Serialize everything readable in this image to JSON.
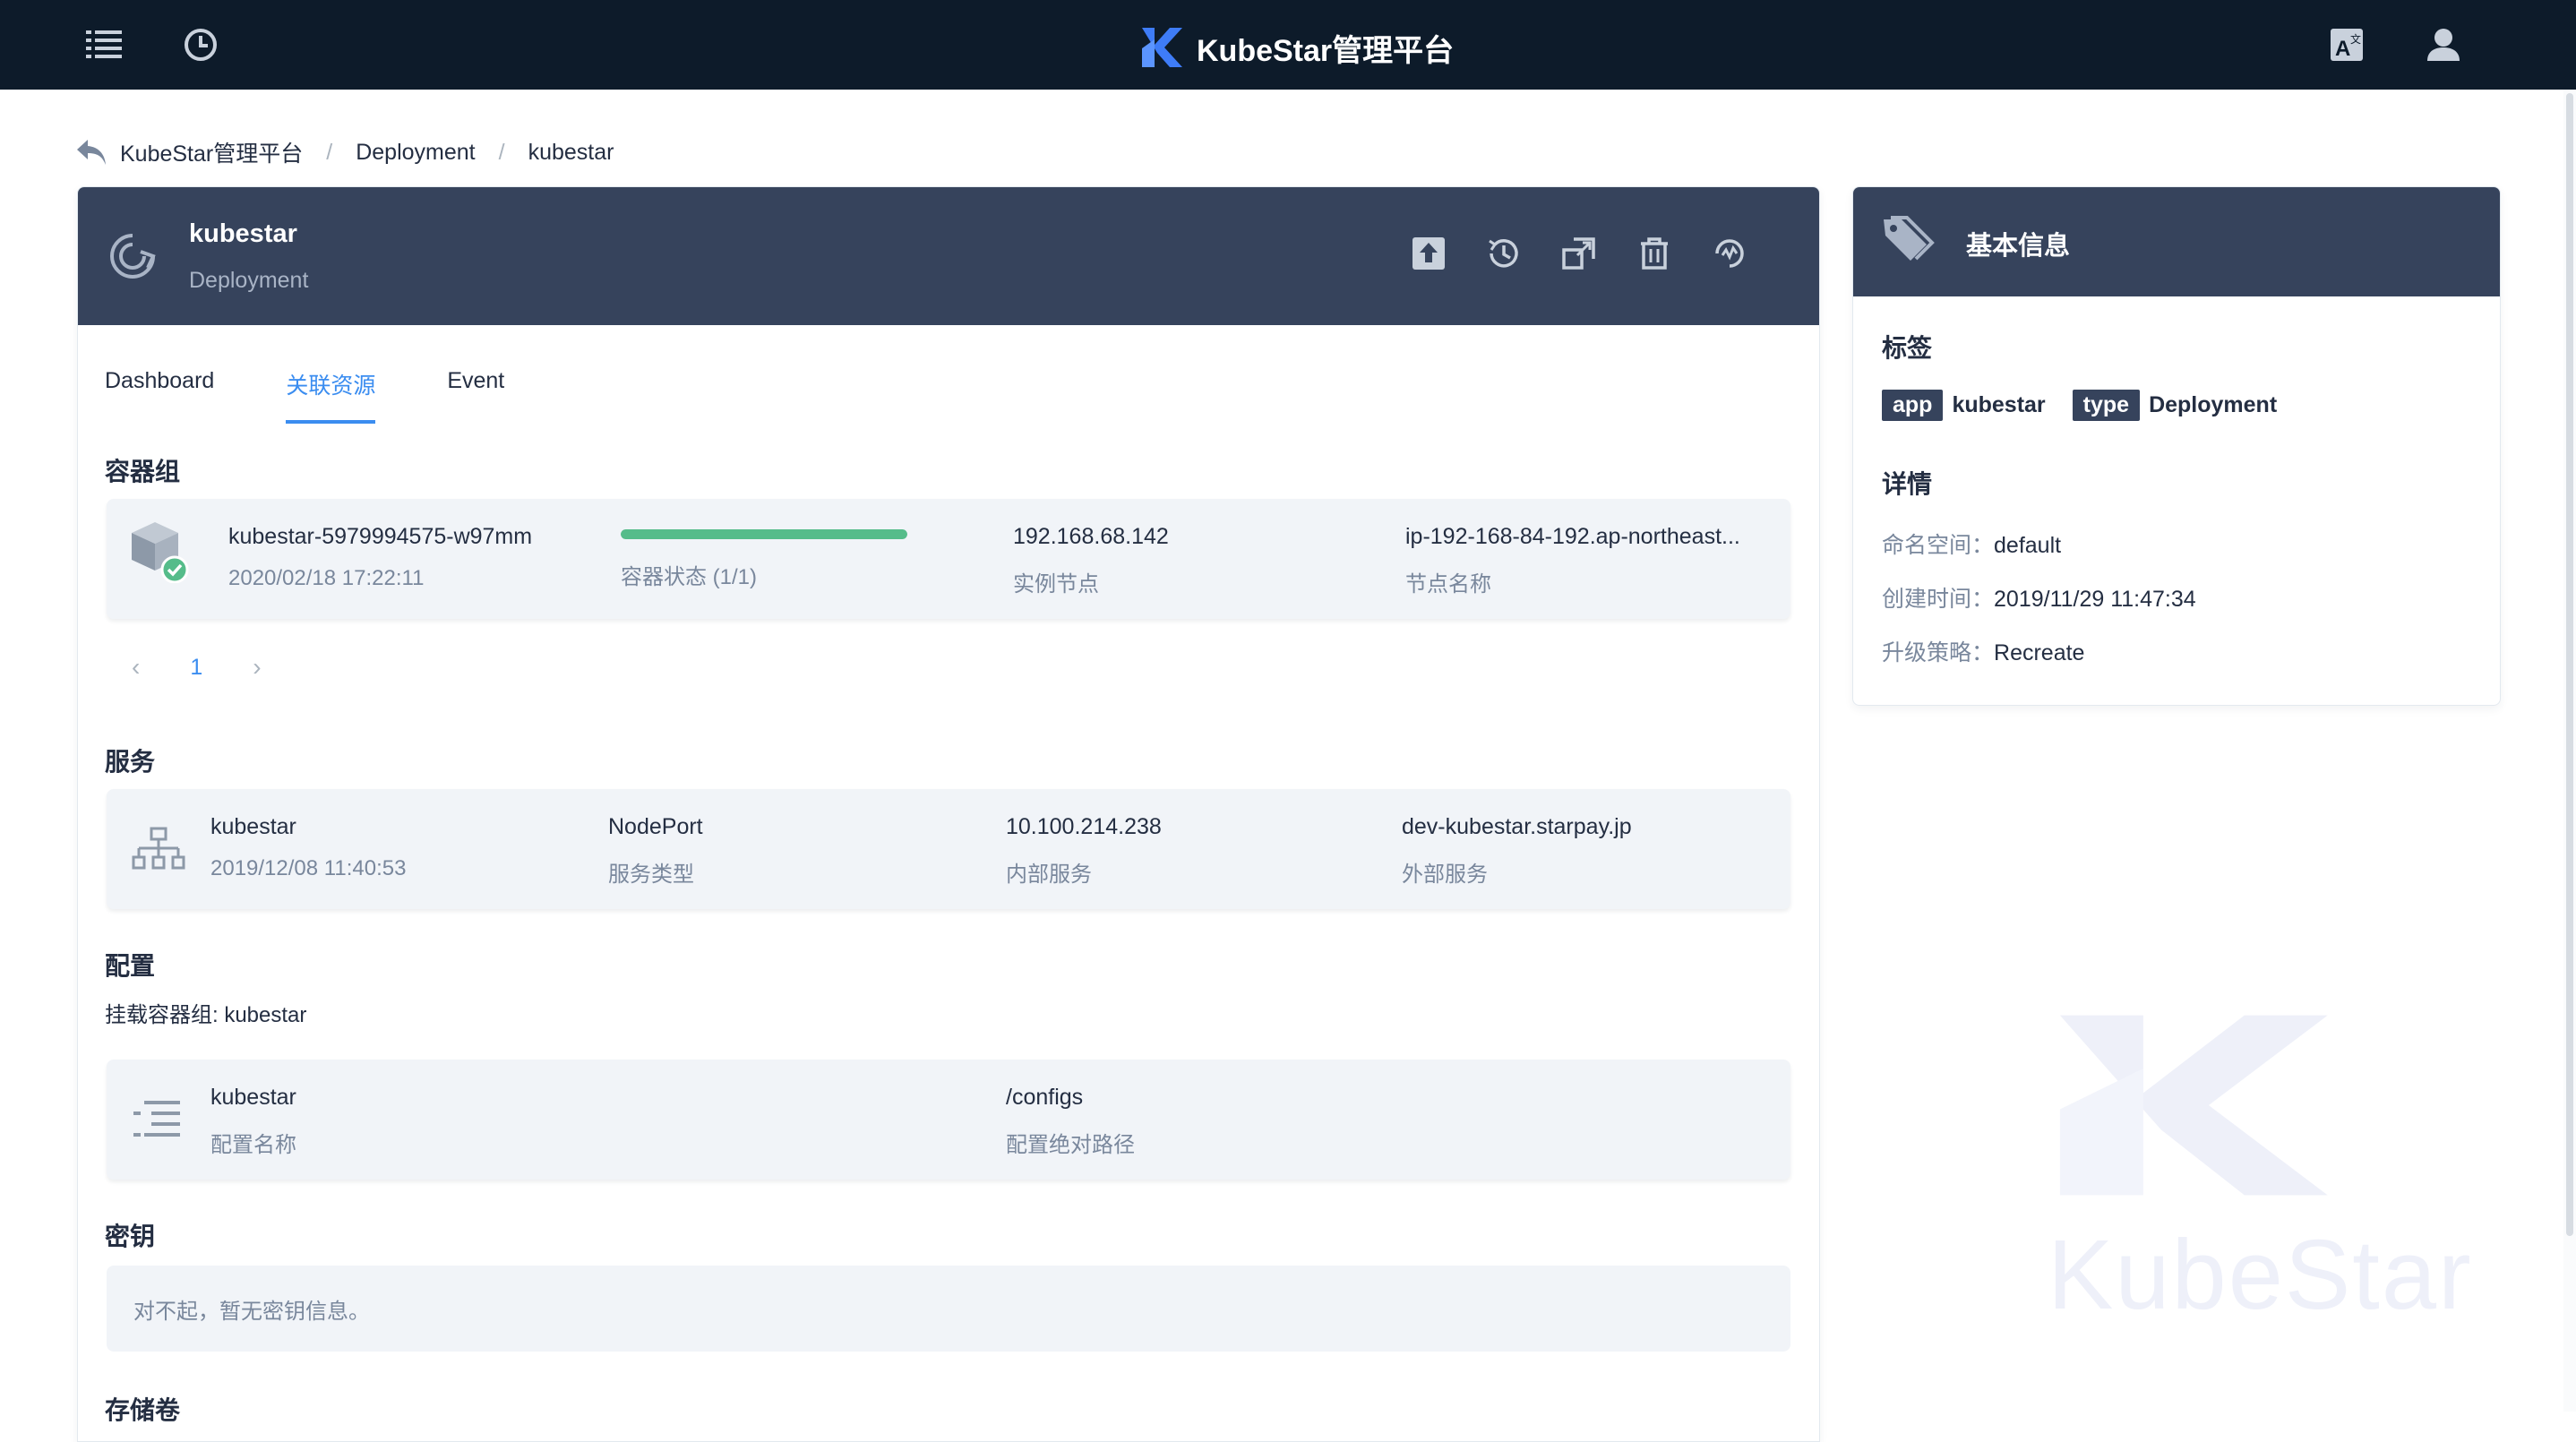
{
  "header": {
    "brand": "KubeStar管理平台",
    "icons": [
      "list-icon",
      "history-icon",
      "translate-icon",
      "user-icon"
    ]
  },
  "breadcrumb": {
    "items": [
      "KubeStar管理平台",
      "Deployment",
      "kubestar"
    ],
    "separator": "/"
  },
  "resource": {
    "name": "kubestar",
    "kind": "Deployment",
    "actions": [
      "upload-icon",
      "history-icon",
      "scale-icon",
      "delete-icon",
      "restart-icon"
    ]
  },
  "tabs": [
    {
      "label": "Dashboard",
      "active": false
    },
    {
      "label": "关联资源",
      "active": true
    },
    {
      "label": "Event",
      "active": false
    }
  ],
  "pods": {
    "title": "容器组",
    "items": [
      {
        "name": "kubestar-5979994575-w97mm",
        "time": "2020/02/18 17:22:11",
        "status_label": "容器状态 (1/1)",
        "ready_fraction": 1.0,
        "ip": "192.168.68.142",
        "ip_label": "实例节点",
        "node": "ip-192-168-84-192.ap-northeast...",
        "node_label": "节点名称"
      }
    ],
    "page": "1",
    "prev": "‹",
    "next": "›"
  },
  "services": {
    "title": "服务",
    "items": [
      {
        "name": "kubestar",
        "time": "2019/12/08 11:40:53",
        "type": "NodePort",
        "type_label": "服务类型",
        "internal": "10.100.214.238",
        "internal_label": "内部服务",
        "external": "dev-kubestar.starpay.jp",
        "external_label": "外部服务"
      }
    ]
  },
  "config": {
    "title": "配置",
    "mount_text": "挂载容器组: kubestar",
    "items": [
      {
        "name": "kubestar",
        "name_label": "配置名称",
        "path": "/configs",
        "path_label": "配置绝对路径"
      }
    ]
  },
  "secrets": {
    "title": "密钥",
    "empty_text": "对不起，暂无密钥信息。"
  },
  "volumes": {
    "title": "存储卷"
  },
  "basic_info": {
    "title": "基本信息",
    "labels_title": "标签",
    "labels": [
      {
        "key": "app",
        "value": "kubestar"
      },
      {
        "key": "type",
        "value": "Deployment"
      }
    ],
    "details_title": "详情",
    "details": [
      {
        "key": "命名空间：",
        "value": "default"
      },
      {
        "key": "创建时间：",
        "value": "2019/11/29 11:47:34"
      },
      {
        "key": "升级策略：",
        "value": "Recreate"
      }
    ]
  },
  "watermark": {
    "text": "KubeStar"
  },
  "colors": {
    "topbar": "#0d1b2a",
    "card_header": "#36435c",
    "accent": "#3b8df0",
    "success": "#55bc8a",
    "row_bg": "#f1f4f8"
  }
}
